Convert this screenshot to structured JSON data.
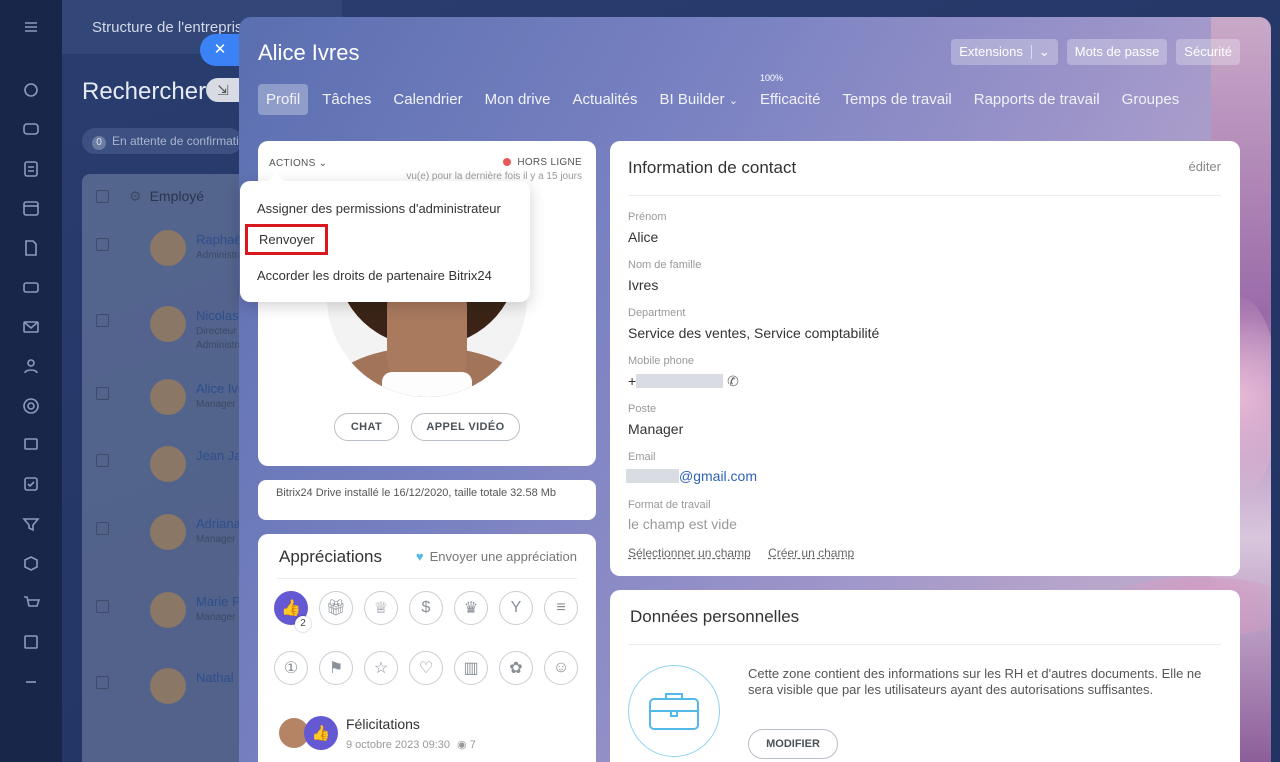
{
  "background": {
    "header_title": "Structure de l'entreprise",
    "search_title": "Rechercher",
    "search_icon": "minimize-arrow-icon",
    "pending_count": "0",
    "pending_label": "En attente de confirmation",
    "table_header": "Employé",
    "rows": [
      {
        "name": "Raphaël",
        "role": "Administrateur"
      },
      {
        "name": "Nicolas",
        "role": "Directeur"
      },
      {
        "name": "Alice Ivres",
        "role": "Manager"
      },
      {
        "name": "Jean Ja",
        "role": ""
      },
      {
        "name": "Adriana",
        "role": "Manager"
      },
      {
        "name": "Marie F",
        "role": "Manager"
      },
      {
        "name": "Nathal",
        "role": ""
      }
    ],
    "rows_extra_role": "Administrateur"
  },
  "slider": {
    "close_icon": "close-icon",
    "title": "Alice Ivres",
    "buttons": {
      "extensions": "Extensions",
      "passwords": "Mots de passe",
      "security": "Sécurité"
    },
    "tabs": [
      {
        "label": "Profil",
        "active": true
      },
      {
        "label": "Tâches"
      },
      {
        "label": "Calendrier"
      },
      {
        "label": "Mon drive"
      },
      {
        "label": "Actualités"
      },
      {
        "label": "BI Builder"
      },
      {
        "label": "Efficacité",
        "sup": "100%"
      },
      {
        "label": "Temps de travail"
      },
      {
        "label": "Rapports de travail"
      },
      {
        "label": "Groupes"
      }
    ]
  },
  "profile": {
    "actions_label": "ACTIONS",
    "status_label": "HORS LIGNE",
    "status_color": "#e85a5a",
    "last_seen": "vu(e) pour la dernière fois il y a 15 jours",
    "chat_button": "CHAT",
    "video_button": "APPEL VIDÉO"
  },
  "actions_menu": {
    "items": [
      {
        "label": "Assigner des permissions d'administrateur"
      },
      {
        "label": "Renvoyer",
        "highlighted": true
      },
      {
        "label": "Accorder les droits de partenaire Bitrix24"
      }
    ]
  },
  "drive": {
    "text": "Bitrix24 Drive installé le 16/12/2020, taille totale 32.58 Mb"
  },
  "appreciations": {
    "title": "Appréciations",
    "send_label": "Envoyer une appréciation",
    "badges_row1": [
      {
        "icon": "thumbs-up-icon",
        "active": true,
        "count": "2"
      },
      {
        "icon": "gift-icon"
      },
      {
        "icon": "trophy-icon"
      },
      {
        "icon": "money-bag-icon"
      },
      {
        "icon": "crown-icon"
      },
      {
        "icon": "cocktail-icon"
      },
      {
        "icon": "cake-icon"
      }
    ],
    "badges_row2": [
      {
        "icon": "number-one-icon"
      },
      {
        "icon": "flag-icon"
      },
      {
        "icon": "star-icon"
      },
      {
        "icon": "heart-icon"
      },
      {
        "icon": "beer-icon"
      },
      {
        "icon": "flower-icon"
      },
      {
        "icon": "smile-icon"
      }
    ],
    "latest": {
      "title": "Félicitations",
      "date": "9 octobre 2023 09:30",
      "views": "7"
    }
  },
  "contact": {
    "title": "Information de contact",
    "edit_label": "éditer",
    "fields": {
      "first_name": {
        "label": "Prénom",
        "value": "Alice"
      },
      "last_name": {
        "label": "Nom de famille",
        "value": "Ivres"
      },
      "department": {
        "label": "Department",
        "value": "Service des ventes, Service comptabilité"
      },
      "mobile": {
        "label": "Mobile phone",
        "value_prefix": "+"
      },
      "position": {
        "label": "Poste",
        "value": "Manager"
      },
      "email": {
        "label": "Email",
        "value_suffix": "@gmail.com"
      },
      "work_format": {
        "label": "Format de travail",
        "value": "le champ est vide"
      }
    },
    "link_select": "Sélectionner un champ",
    "link_create": "Créer un champ"
  },
  "personal": {
    "title": "Données personnelles",
    "text": "Cette zone contient des informations sur les RH et d'autres documents. Elle ne sera visible que par les utilisateurs ayant des autorisations suffisantes.",
    "button": "MODIFIER"
  }
}
